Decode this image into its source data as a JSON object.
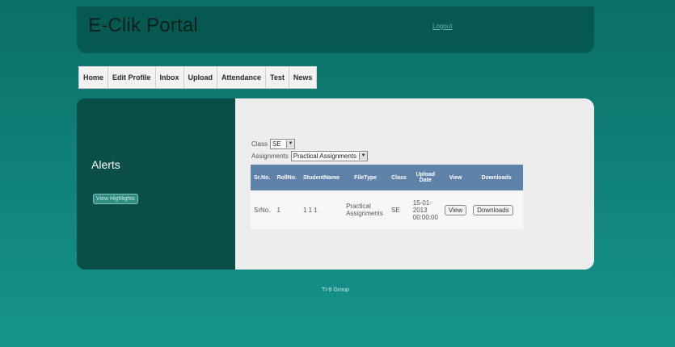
{
  "header": {
    "logo": "E-Clik Portal",
    "logout": "Logout"
  },
  "nav": {
    "items": [
      "Home",
      "Edit Profile",
      "Inbox",
      "Upload",
      "Attendance",
      "Test",
      "News"
    ]
  },
  "sidebar": {
    "title": "Alerts",
    "highlights_button": "View Highlights"
  },
  "form": {
    "class_label": "Class",
    "class_value": "SE",
    "assignments_label": "Assignments",
    "assignments_value": "Practical Assignments"
  },
  "table": {
    "headers": [
      "Sr.No.",
      "RollNo.",
      "StudentName",
      "FileType",
      "Class",
      "Upload Date",
      "View",
      "Downloads"
    ],
    "rows": [
      {
        "srno": "SrNo.",
        "rollno": "1",
        "studentname": "1 1 1",
        "filetype": "Practical Assignments",
        "class": "SE",
        "upload_date": "15-01-2013 00:00:00",
        "view_button": "View",
        "downloads_button": "Downloads"
      }
    ]
  },
  "footer": {
    "text": "TI-9 Group"
  }
}
